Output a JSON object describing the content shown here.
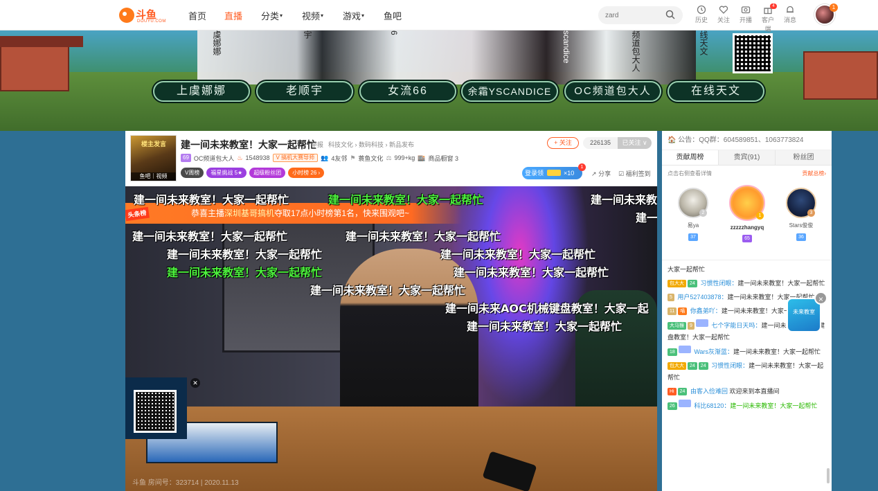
{
  "nav": {
    "logo_text": "斗鱼",
    "logo_sub": "DOUYU.COM",
    "items": [
      {
        "label": "首页",
        "active": false,
        "caret": false
      },
      {
        "label": "直播",
        "active": true,
        "caret": false
      },
      {
        "label": "分类",
        "active": false,
        "caret": true
      },
      {
        "label": "视频",
        "active": false,
        "caret": true
      },
      {
        "label": "游戏",
        "active": false,
        "caret": true
      },
      {
        "label": "鱼吧",
        "active": false,
        "caret": false
      }
    ],
    "search_placeholder": "zard",
    "icons": [
      {
        "label": "历史",
        "icon": "clock-icon"
      },
      {
        "label": "关注",
        "icon": "heart-icon"
      },
      {
        "label": "开播",
        "icon": "camera-icon"
      },
      {
        "label": "客户端",
        "icon": "gift-box-icon",
        "badge": "4"
      },
      {
        "label": "消息",
        "icon": "bell-icon"
      }
    ],
    "avatar_badge": "1"
  },
  "banner": {
    "names": [
      "上虞娜娜",
      "老顺宇",
      "女流66",
      "余霜YSCANDICE",
      "OC频道包大人",
      "在线天文"
    ],
    "vertical_texts": [
      "虞娜娜",
      "宇",
      "6",
      "scandice",
      "频道包大人",
      "线天文"
    ]
  },
  "room": {
    "thumb_title": "楼主发言",
    "thumb_bottom": "鱼吧｜视频",
    "title": "建一间未来教室！大家一起帮忙",
    "report": "举报",
    "category_path": "科技文化 › 数码科技 › 新品发布",
    "level": "69",
    "anchor_name": "OC频道包大人",
    "heat": "1548938",
    "tag": "V 搞机大赛导师",
    "clan": "4友邻",
    "guild": "蓑鱼文化",
    "weight": "999+kg",
    "shop": "商品橱窗 3",
    "chips": [
      {
        "label": "V周榜",
        "color": "#4a4a4a"
      },
      {
        "label": "福星挑战 5★",
        "color": "#9b3fe0"
      },
      {
        "label": "超级粉丝团",
        "color": "#b33ad9"
      },
      {
        "label": "小时榜 26 ›",
        "color": "#ff6a1a"
      }
    ],
    "follow_label": "+ 关注",
    "fans_count": "226135",
    "followed_label": "已关注 ∨",
    "login_gift": "登录领",
    "login_gift_count": "×10",
    "login_gift_badge": "1",
    "share_label": "分享",
    "welfare_label": "福利签到"
  },
  "video": {
    "notice_prefix": "恭喜主播",
    "notice_highlight": "深圳基哥搞机",
    "notice_suffix": "夺取17点小时榜第1名，快来围观吧~",
    "notice_tag": "头条榜",
    "danmu": [
      {
        "text": "建一间未来教室！大家一起帮忙",
        "green": false
      },
      {
        "text": "建一间未来教室！大家一起帮忙",
        "green": true
      },
      {
        "text": "建一间未来教室！大家一起帮忙",
        "green": false
      },
      {
        "text": "建一间未来教室！大家一起帮忙",
        "green": false
      },
      {
        "text": "建一间未来教室！大家一起帮忙",
        "green": false
      },
      {
        "text": "建一间未来教室！大家一起帮忙",
        "green": false
      },
      {
        "text": "建一间未来教室！大家一起帮忙",
        "green": false
      },
      {
        "text": "建一间未来教室！大家一起帮忙",
        "green": true
      },
      {
        "text": "建一间未来教室！大家一起帮忙",
        "green": false
      },
      {
        "text": "建一间未来教室！大家一起帮忙",
        "green": false
      },
      {
        "text": "建一间未来AOC机械键盘教室！大家一起",
        "green": false
      },
      {
        "text": "建一间未来教室！大家一起帮忙",
        "green": false
      },
      {
        "text": "建一",
        "green": false
      },
      {
        "text": "建一间未来教室！大家一起帮忙",
        "green": false
      }
    ],
    "watermark": "斗鱼 房间号：323714 | 2020.11.13"
  },
  "side": {
    "notice": "公告：QQ群：604589851、1063773824",
    "tabs": [
      {
        "label": "贡献周榜",
        "active": true
      },
      {
        "label": "贵宾(91)",
        "active": false
      },
      {
        "label": "粉丝团",
        "active": false
      }
    ],
    "rank_hint": "点击右侧查看详情",
    "rank_more": "贡献总榜›",
    "top3": [
      {
        "name": "易ya",
        "level": "37",
        "pos": "2"
      },
      {
        "name": "zzzzzhangyq",
        "level": "65",
        "pos": "1"
      },
      {
        "name": "Stars俊俊",
        "level": "36",
        "pos": "3"
      }
    ],
    "chat": [
      {
        "tags": [],
        "user": "",
        "text": "大家一起帮忙",
        "style": "or"
      },
      {
        "tags": [
          {
            "t": "包大大",
            "c": "#f2a900"
          },
          {
            "t": "24",
            "c": "#4ac07a"
          }
        ],
        "user": "习惯性闭眼：",
        "text": "建一间未来教室！大家一起帮忙",
        "style": ""
      },
      {
        "tags": [
          {
            "t": "5",
            "c": "#d9b46a"
          }
        ],
        "user": "用户527403878：",
        "text": "建一间未来教室！大家一起帮忙",
        "style": ""
      },
      {
        "tags": [
          {
            "t": "11",
            "c": "#d9b46a"
          },
          {
            "t": "喵",
            "c": "#ff7a1a"
          }
        ],
        "user": "你鑫弟吖：",
        "text": "建一间未来教室！大家一起帮忙",
        "style": ""
      },
      {
        "tags": [
          {
            "t": "大马猴",
            "c": "#4ac07a"
          },
          {
            "t": "9",
            "c": "#d9b46a"
          },
          {
            "t": "",
            "c": "#9bb4ff"
          }
        ],
        "user": "七个字能日天吗：",
        "text": "建一间未来AOC机械键盘教室！大家一起帮忙",
        "style": ""
      },
      {
        "tags": [
          {
            "t": "18",
            "c": "#4ac07a"
          },
          {
            "t": "",
            "c": "#9bb4ff"
          }
        ],
        "user": "Wars灰渐蓝：",
        "text": "建一间未来教室！大家一起帮忙",
        "style": ""
      },
      {
        "tags": [
          {
            "t": "包大大",
            "c": "#f2a900"
          },
          {
            "t": "24",
            "c": "#4ac07a"
          },
          {
            "t": "24",
            "c": "#4ac07a"
          }
        ],
        "user": "习惯性闭眼：",
        "text": "建一间未来教室！大家一起帮忙",
        "style": ""
      },
      {
        "tags": [
          {
            "t": "Hi",
            "c": "#ff5d23"
          },
          {
            "t": "24",
            "c": "#4ac07a"
          }
        ],
        "user": "由客入俭难回",
        "text": "欢迎来到本直播间",
        "style": ""
      },
      {
        "tags": [
          {
            "t": "26",
            "c": "#4ac07a"
          },
          {
            "t": "",
            "c": "#9bb4ff"
          }
        ],
        "user": "科比68120：",
        "text": "建一间未来教室！大家一起帮忙",
        "style": "hlg"
      }
    ],
    "float_ad_text": "未来教室",
    "float_close": "×"
  }
}
